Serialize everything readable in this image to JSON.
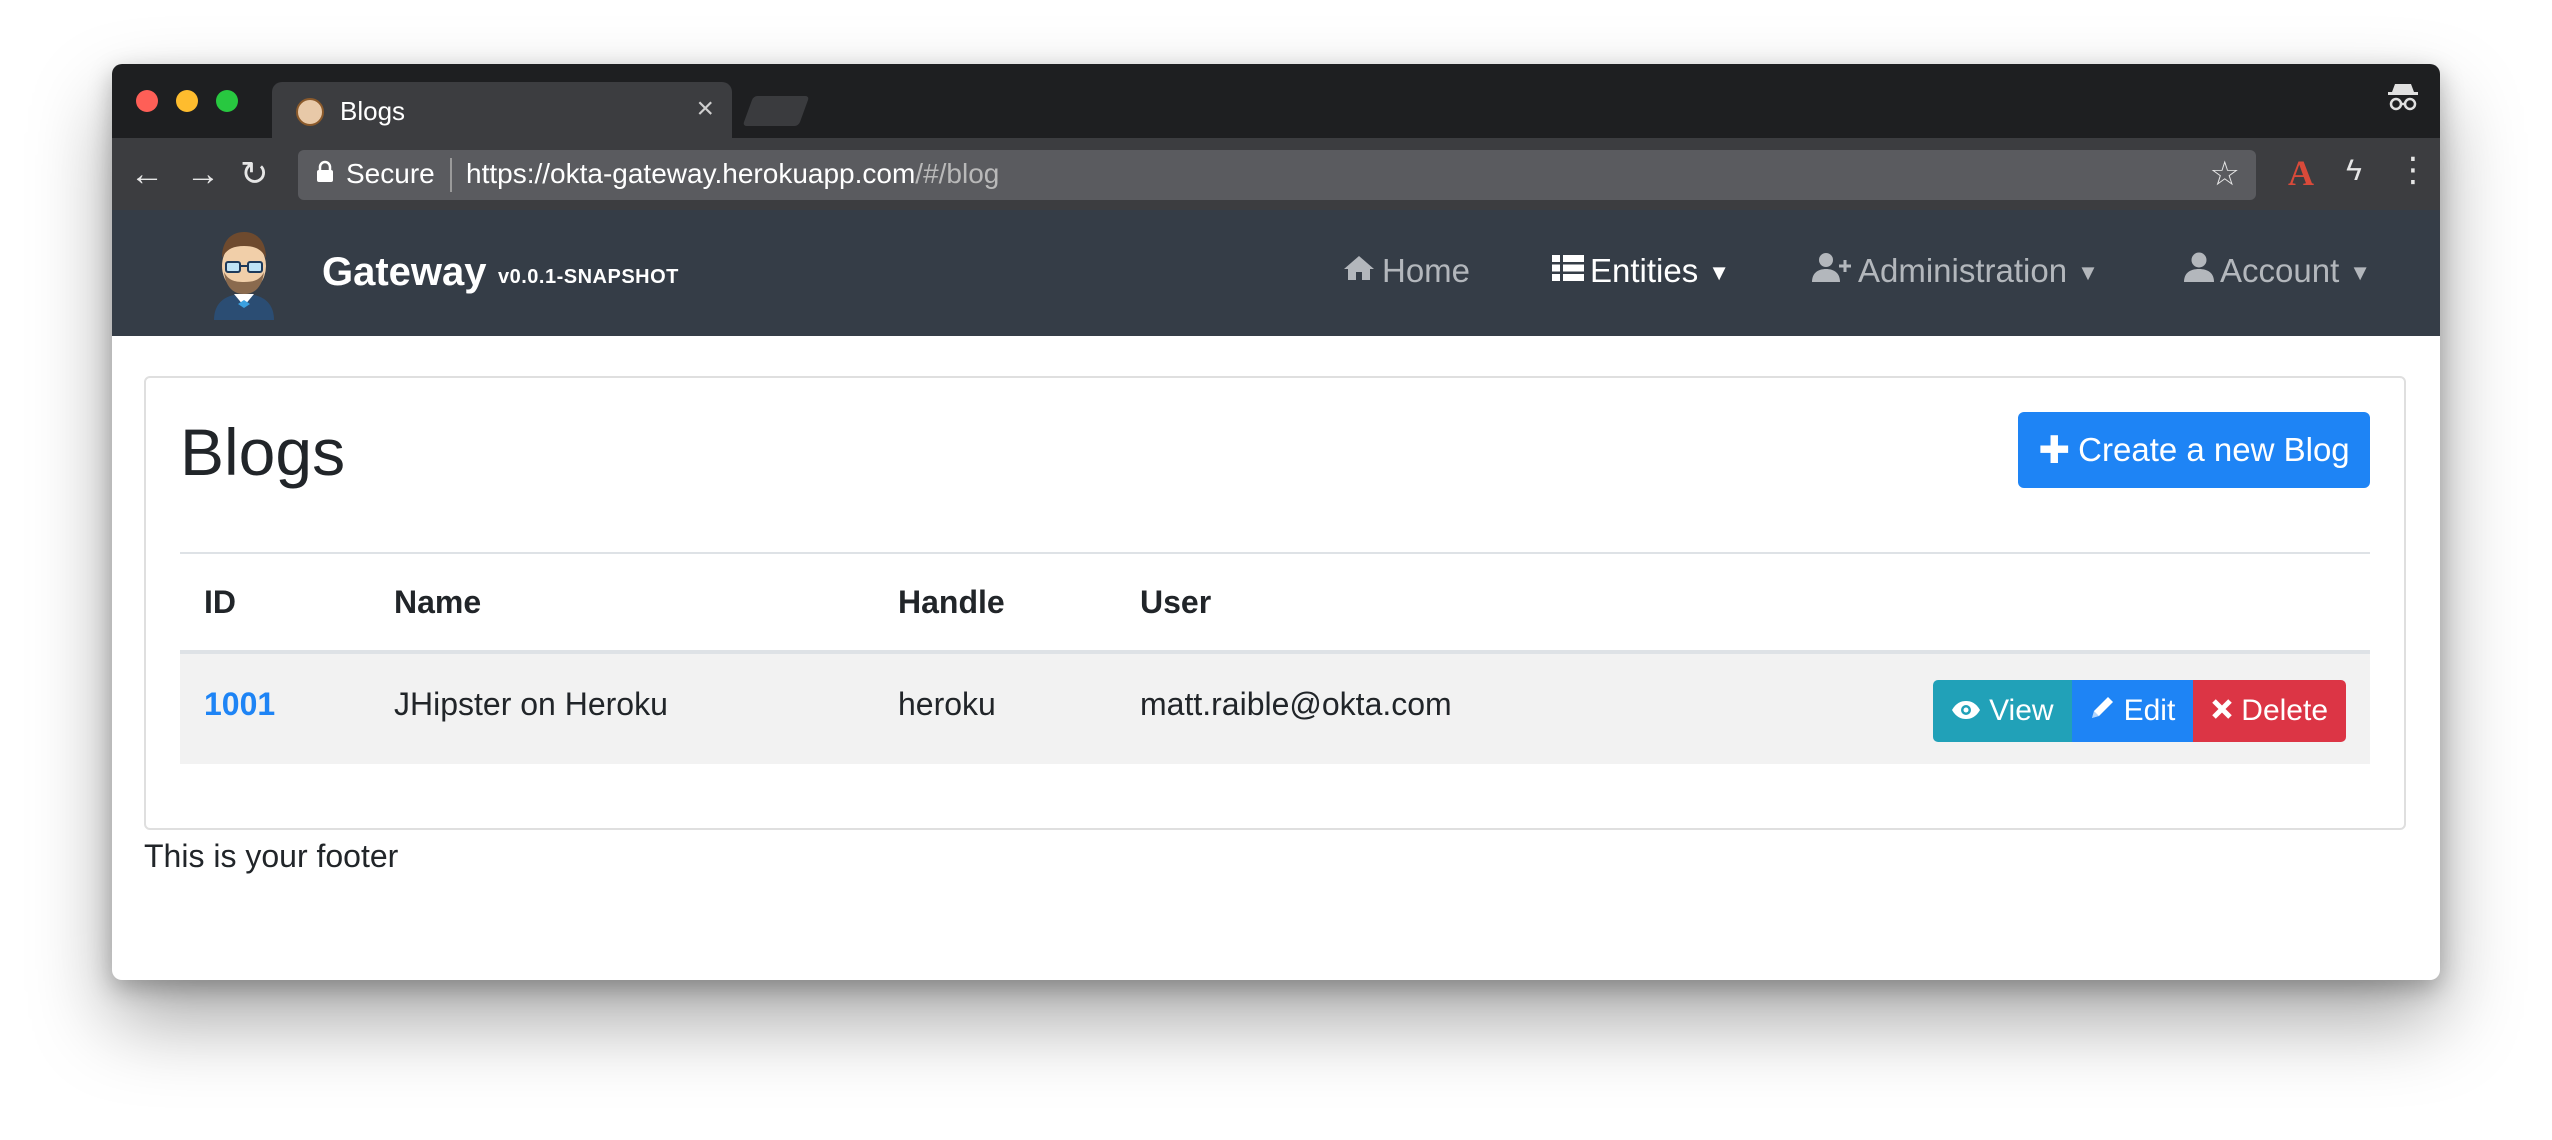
{
  "browser": {
    "tab_title": "Blogs",
    "tab_close": "×",
    "secure_label": "Secure",
    "url_main": "https://okta-gateway.herokuapp.com",
    "url_hash": "/#/blog",
    "icons": {
      "back": "arrow-left-icon",
      "forward": "arrow-right-icon",
      "reload": "reload-icon",
      "lock": "lock-icon",
      "star": "star-icon",
      "extension_a": "acrobat-icon",
      "extension_bolt": "bolt-icon",
      "menu": "more-vert-icon",
      "incognito": "incognito-icon"
    }
  },
  "navbar": {
    "brand": "Gateway",
    "version": "v0.0.1-SNAPSHOT",
    "items": [
      {
        "label": "Home",
        "icon": "home-icon"
      },
      {
        "label": "Entities",
        "icon": "th-list-icon"
      },
      {
        "label": "Administration",
        "icon": "user-plus-icon"
      },
      {
        "label": "Account",
        "icon": "user-icon"
      }
    ]
  },
  "page": {
    "title": "Blogs",
    "create_button": "Create a new Blog",
    "table": {
      "headers": [
        "ID",
        "Name",
        "Handle",
        "User"
      ],
      "rows": [
        {
          "id": "1001",
          "name": "JHipster on Heroku",
          "handle": "heroku",
          "user": "matt.raible@okta.com"
        }
      ],
      "actions": {
        "view": "View",
        "edit": "Edit",
        "delete": "Delete"
      }
    }
  },
  "footer": {
    "text": "This is your footer"
  },
  "colors": {
    "navbar_bg": "#353d47",
    "primary": "#1e84f5",
    "info": "#21a1b8",
    "danger": "#dc3545"
  }
}
